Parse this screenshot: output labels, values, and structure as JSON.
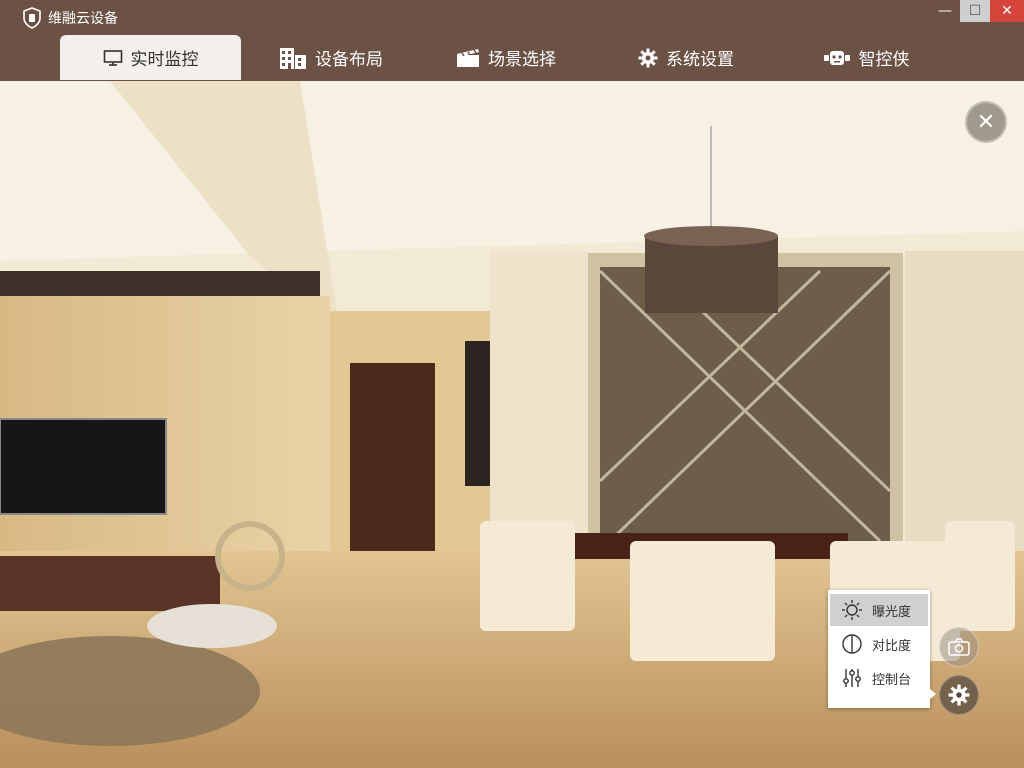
{
  "app": {
    "title": "维融云设备"
  },
  "window": {
    "minimize": "—",
    "maximize": "☐",
    "close": "✕"
  },
  "nav": {
    "tabs": [
      {
        "label": "实时监控",
        "icon": "monitor-icon",
        "active": true
      },
      {
        "label": "设备布局",
        "icon": "building-icon",
        "active": false
      },
      {
        "label": "场景选择",
        "icon": "clapperboard-icon",
        "active": false
      },
      {
        "label": "系统设置",
        "icon": "gear-icon",
        "active": false
      },
      {
        "label": "智控侠",
        "icon": "robot-icon",
        "active": false
      }
    ]
  },
  "camera_menu": {
    "items": [
      {
        "label": "曝光度",
        "icon": "sun-icon",
        "selected": true
      },
      {
        "label": "对比度",
        "icon": "contrast-icon",
        "selected": false
      },
      {
        "label": "控制台",
        "icon": "sliders-icon",
        "selected": false
      }
    ]
  },
  "colors": {
    "titlebar": "#6b5244",
    "active_tab": "#f2efec",
    "close": "#d6453b"
  }
}
